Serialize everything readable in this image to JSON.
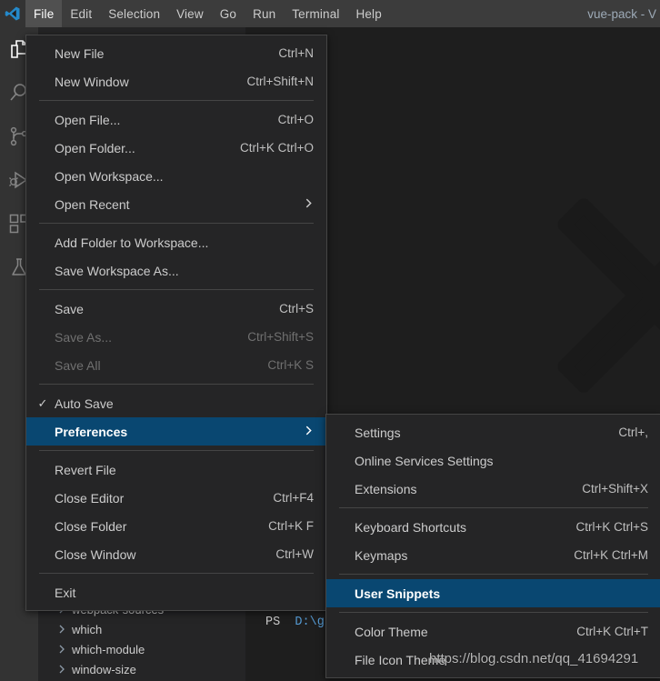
{
  "window": {
    "title": "vue-pack - V",
    "logo_icon": "vscode-logo-icon"
  },
  "menubar": {
    "items": [
      {
        "label": "File",
        "active": true
      },
      {
        "label": "Edit",
        "active": false
      },
      {
        "label": "Selection",
        "active": false
      },
      {
        "label": "View",
        "active": false
      },
      {
        "label": "Go",
        "active": false
      },
      {
        "label": "Run",
        "active": false
      },
      {
        "label": "Terminal",
        "active": false
      },
      {
        "label": "Help",
        "active": false
      }
    ]
  },
  "activitybar": {
    "items": [
      {
        "icon": "files-explorer-icon",
        "name": "activity-explorer"
      },
      {
        "icon": "search-icon",
        "name": "activity-search"
      },
      {
        "icon": "source-control-icon",
        "name": "activity-source-control"
      },
      {
        "icon": "run-and-debug-icon",
        "name": "activity-run-debug"
      },
      {
        "icon": "extensions-icon",
        "name": "activity-extensions"
      },
      {
        "icon": "testing-flask-icon",
        "name": "activity-testing"
      }
    ]
  },
  "sidebar": {
    "tree_items": [
      {
        "label": "webpack-sources",
        "chevron": "chevron-right-icon"
      },
      {
        "label": "which",
        "chevron": "chevron-right-icon"
      },
      {
        "label": "which-module",
        "chevron": "chevron-right-icon"
      },
      {
        "label": "window-size",
        "chevron": "chevron-right-icon"
      }
    ]
  },
  "terminal": {
    "prompt_ps": "PS",
    "prompt_path": "D:\\g",
    "separator": ":"
  },
  "file_menu": {
    "items": [
      {
        "type": "item",
        "label": "New File",
        "key": "Ctrl+N",
        "checked": false,
        "disabled": false,
        "submenu": false,
        "selected": false
      },
      {
        "type": "item",
        "label": "New Window",
        "key": "Ctrl+Shift+N",
        "checked": false,
        "disabled": false,
        "submenu": false,
        "selected": false
      },
      {
        "type": "sep"
      },
      {
        "type": "item",
        "label": "Open File...",
        "key": "Ctrl+O",
        "checked": false,
        "disabled": false,
        "submenu": false,
        "selected": false
      },
      {
        "type": "item",
        "label": "Open Folder...",
        "key": "Ctrl+K Ctrl+O",
        "checked": false,
        "disabled": false,
        "submenu": false,
        "selected": false
      },
      {
        "type": "item",
        "label": "Open Workspace...",
        "key": "",
        "checked": false,
        "disabled": false,
        "submenu": false,
        "selected": false
      },
      {
        "type": "item",
        "label": "Open Recent",
        "key": "",
        "checked": false,
        "disabled": false,
        "submenu": true,
        "selected": false
      },
      {
        "type": "sep"
      },
      {
        "type": "item",
        "label": "Add Folder to Workspace...",
        "key": "",
        "checked": false,
        "disabled": false,
        "submenu": false,
        "selected": false
      },
      {
        "type": "item",
        "label": "Save Workspace As...",
        "key": "",
        "checked": false,
        "disabled": false,
        "submenu": false,
        "selected": false
      },
      {
        "type": "sep"
      },
      {
        "type": "item",
        "label": "Save",
        "key": "Ctrl+S",
        "checked": false,
        "disabled": false,
        "submenu": false,
        "selected": false
      },
      {
        "type": "item",
        "label": "Save As...",
        "key": "Ctrl+Shift+S",
        "checked": false,
        "disabled": true,
        "submenu": false,
        "selected": false
      },
      {
        "type": "item",
        "label": "Save All",
        "key": "Ctrl+K S",
        "checked": false,
        "disabled": true,
        "submenu": false,
        "selected": false
      },
      {
        "type": "sep"
      },
      {
        "type": "item",
        "label": "Auto Save",
        "key": "",
        "checked": true,
        "disabled": false,
        "submenu": false,
        "selected": false
      },
      {
        "type": "item",
        "label": "Preferences",
        "key": "",
        "checked": false,
        "disabled": false,
        "submenu": true,
        "selected": true
      },
      {
        "type": "sep"
      },
      {
        "type": "item",
        "label": "Revert File",
        "key": "",
        "checked": false,
        "disabled": false,
        "submenu": false,
        "selected": false
      },
      {
        "type": "item",
        "label": "Close Editor",
        "key": "Ctrl+F4",
        "checked": false,
        "disabled": false,
        "submenu": false,
        "selected": false
      },
      {
        "type": "item",
        "label": "Close Folder",
        "key": "Ctrl+K F",
        "checked": false,
        "disabled": false,
        "submenu": false,
        "selected": false
      },
      {
        "type": "item",
        "label": "Close Window",
        "key": "Ctrl+W",
        "checked": false,
        "disabled": false,
        "submenu": false,
        "selected": false
      },
      {
        "type": "sep"
      },
      {
        "type": "item",
        "label": "Exit",
        "key": "",
        "checked": false,
        "disabled": false,
        "submenu": false,
        "selected": false
      }
    ]
  },
  "preferences_menu": {
    "items": [
      {
        "type": "item",
        "label": "Settings",
        "key": "Ctrl+,",
        "selected": false
      },
      {
        "type": "item",
        "label": "Online Services Settings",
        "key": "",
        "selected": false
      },
      {
        "type": "item",
        "label": "Extensions",
        "key": "Ctrl+Shift+X",
        "selected": false
      },
      {
        "type": "sep"
      },
      {
        "type": "item",
        "label": "Keyboard Shortcuts",
        "key": "Ctrl+K Ctrl+S",
        "selected": false
      },
      {
        "type": "item",
        "label": "Keymaps",
        "key": "Ctrl+K Ctrl+M",
        "selected": false
      },
      {
        "type": "sep"
      },
      {
        "type": "item",
        "label": "User Snippets",
        "key": "",
        "selected": true
      },
      {
        "type": "sep"
      },
      {
        "type": "item",
        "label": "Color Theme",
        "key": "Ctrl+K Ctrl+T",
        "selected": false
      },
      {
        "type": "item",
        "label": "File Icon Theme",
        "key": "",
        "selected": false
      }
    ]
  },
  "watermark": {
    "text": "https://blog.csdn.net/qq_41694291"
  },
  "colors": {
    "titlebar_bg": "#3c3c3c",
    "menu_bg": "#252526",
    "menu_border": "#454545",
    "selection_blue": "#094771",
    "activitybar_bg": "#333333",
    "editor_bg": "#1e1e1e",
    "text": "#cccccc",
    "disabled_text": "#707070"
  }
}
